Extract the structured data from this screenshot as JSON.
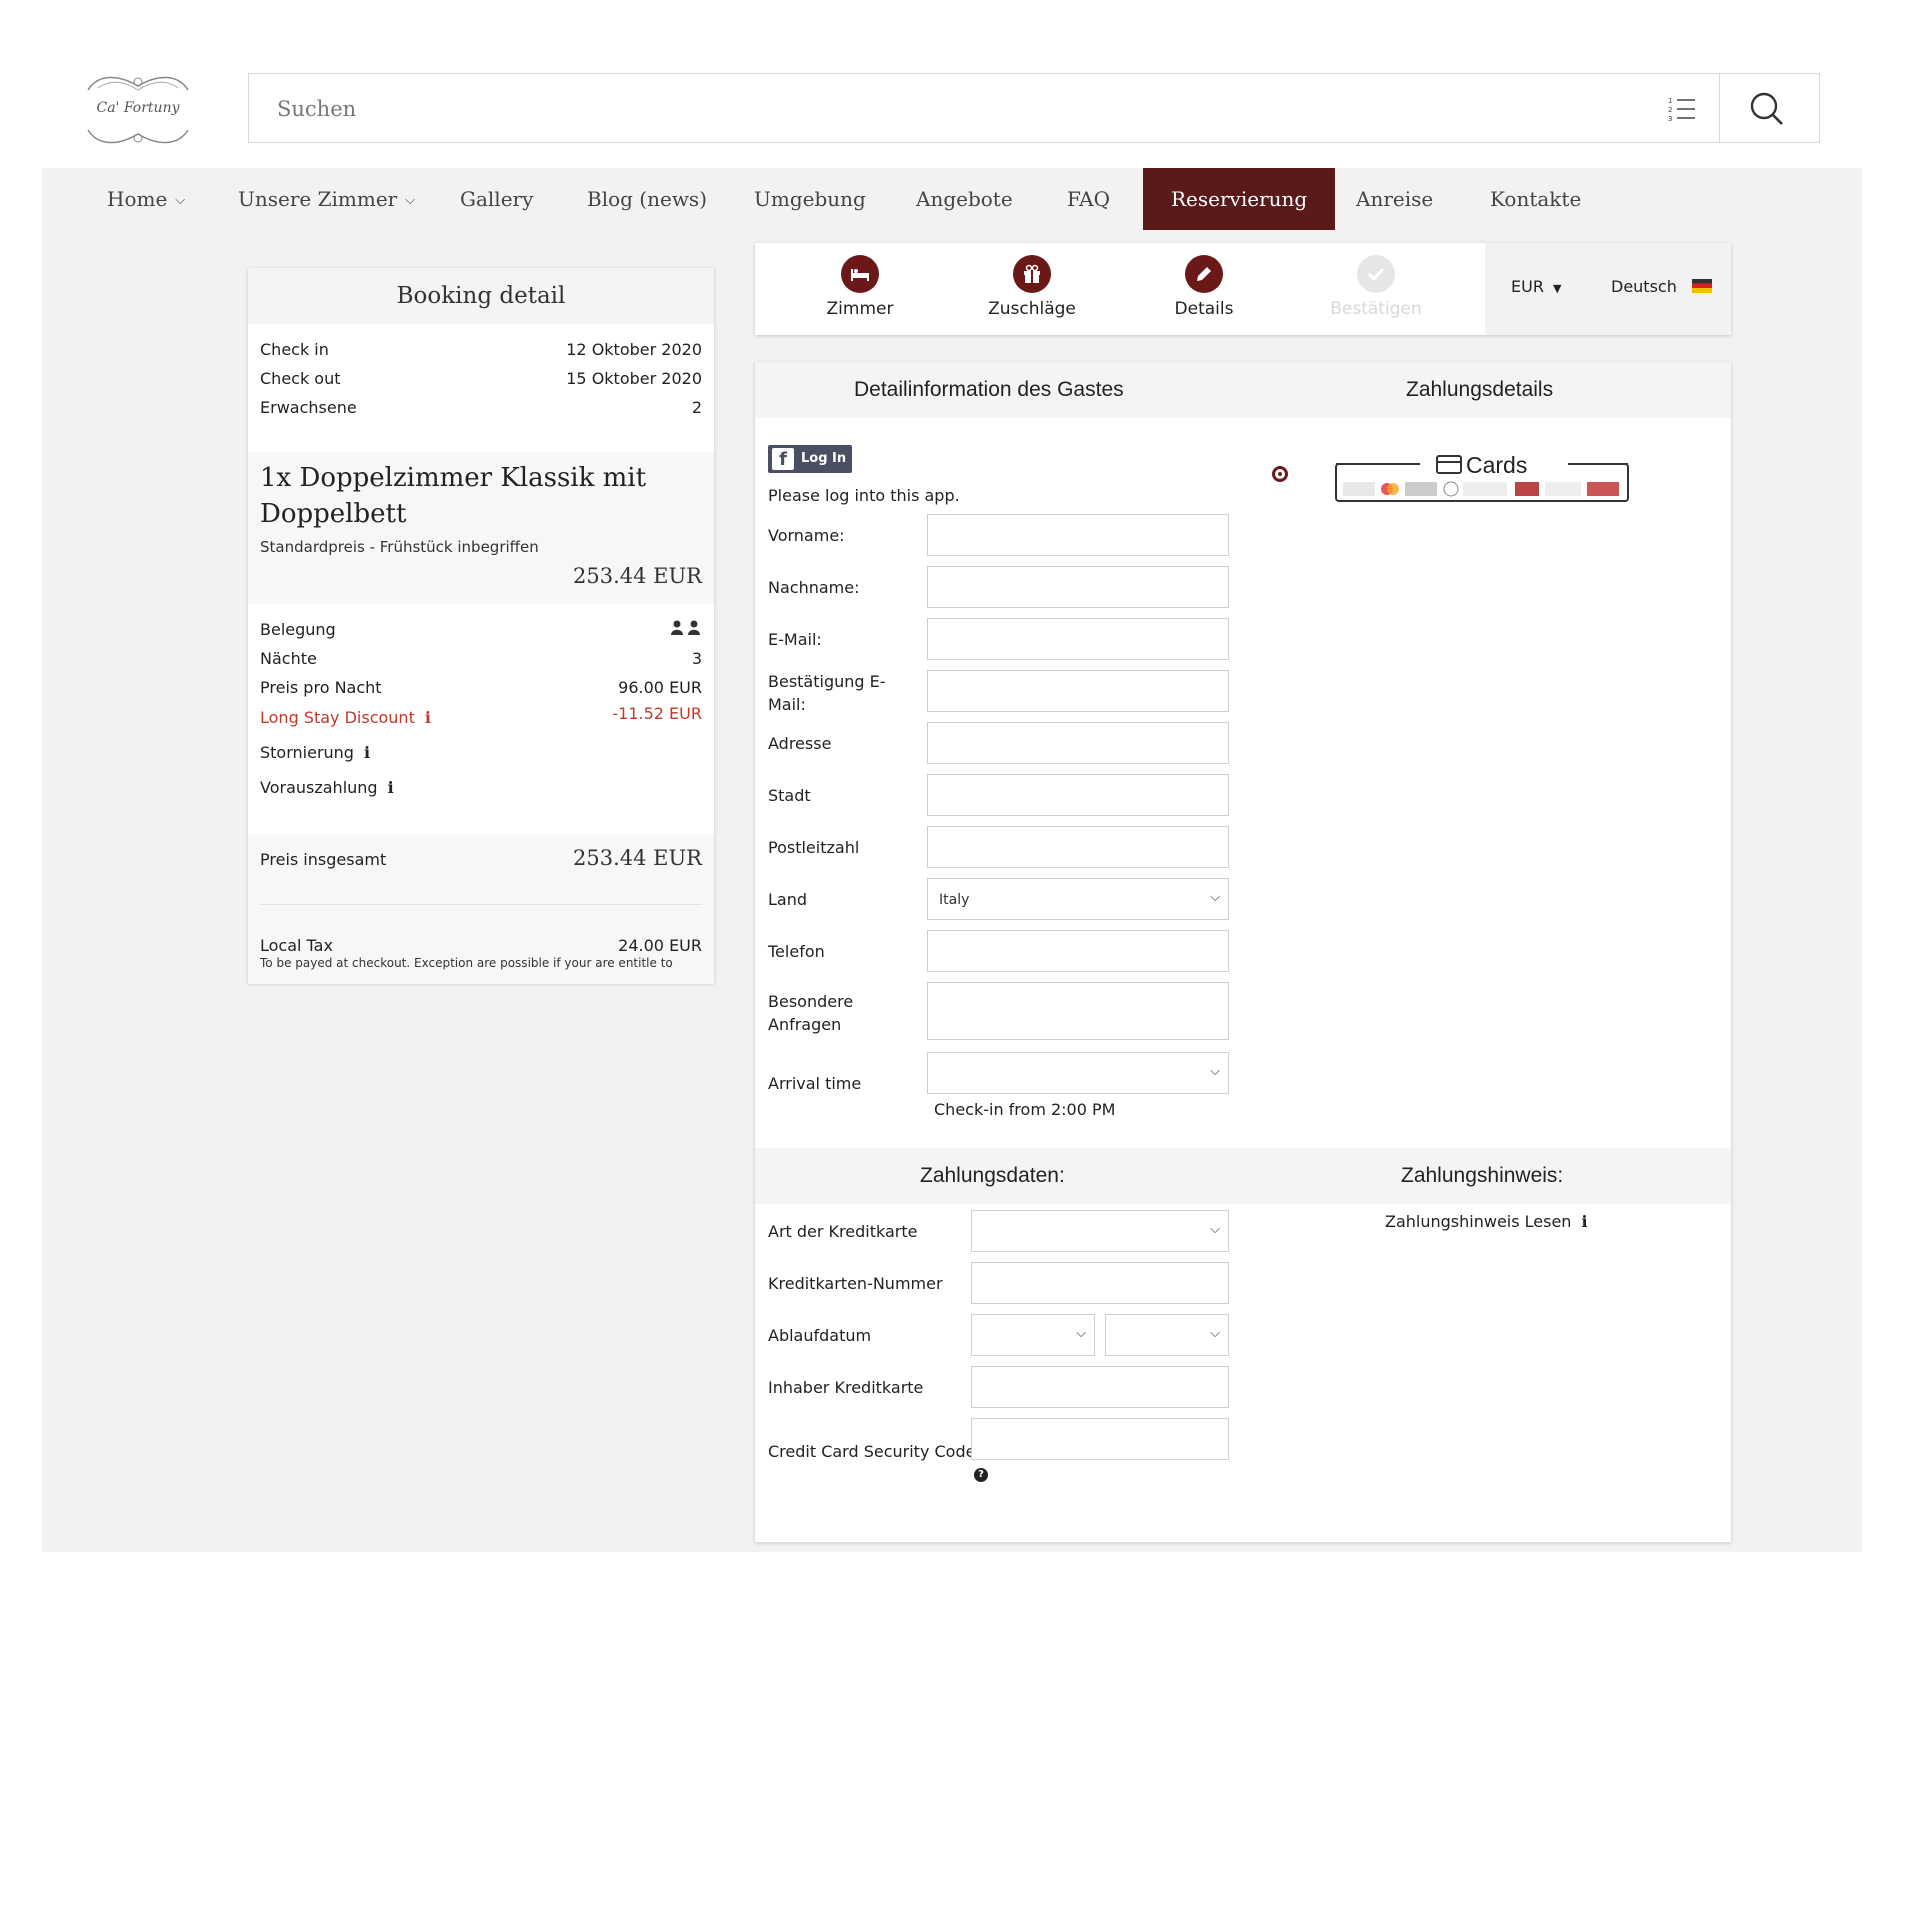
{
  "logo": {
    "text": "Ca' Fortuny"
  },
  "search": {
    "placeholder": "Suchen"
  },
  "nav": {
    "items": [
      "Home",
      "Unsere Zimmer",
      "Gallery",
      "Blog (news)",
      "Umgebung",
      "Angebote",
      "FAQ",
      "Reservierung",
      "Anreise",
      "Kontakte"
    ],
    "active": "Reservierung"
  },
  "booking": {
    "title": "Booking detail",
    "check_in_label": "Check in",
    "check_in": "12 Oktober 2020",
    "check_out_label": "Check out",
    "check_out": "15 Oktober 2020",
    "adults_label": "Erwachsene",
    "adults": "2",
    "room_title": "1x Doppelzimmer Klassik mit Doppelbett",
    "room_rate": "Standardpreis - Frühstück inbegriffen",
    "room_price": "253.44 EUR",
    "occupancy_label": "Belegung",
    "nights_label": "Nächte",
    "nights": "3",
    "price_per_night_label": "Preis pro Nacht",
    "price_per_night": "96.00 EUR",
    "discount_label": "Long Stay Discount",
    "discount": "-11.52 EUR",
    "cancellation_label": "Stornierung",
    "prepayment_label": "Vorauszahlung",
    "total_label": "Preis insgesamt",
    "total": "253.44 EUR",
    "local_tax_label": "Local Tax",
    "local_tax": "24.00 EUR",
    "local_tax_note": "To be payed at checkout. Exception are possible if your are entitle to"
  },
  "steps": [
    {
      "label": "Zimmer",
      "icon": "bed-icon"
    },
    {
      "label": "Zuschläge",
      "icon": "gift-icon"
    },
    {
      "label": "Details",
      "icon": "pencil-icon"
    },
    {
      "label": "Bestätigen",
      "icon": "check-icon"
    }
  ],
  "currency": "EUR",
  "language": "Deutsch",
  "form": {
    "guest_header": "Detailinformation des Gastes",
    "payment_header": "Zahlungsdetails",
    "fb_login": "Log In",
    "login_prompt": "Please log into this app.",
    "labels": {
      "first_name": "Vorname:",
      "last_name": "Nachname:",
      "email": "E-Mail:",
      "email_confirm": "Bestätigung E-Mail:",
      "address": "Adresse",
      "city": "Stadt",
      "zip": "Postleitzahl",
      "country": "Land",
      "phone": "Telefon",
      "requests": "Besondere Anfragen",
      "arrival": "Arrival time"
    },
    "country_value": "Italy",
    "checkin_hint": "Check-in from 2:00 PM",
    "cards_label": "Cards",
    "payment_data_header": "Zahlungsdaten:",
    "payment_note_header": "Zahlungshinweis:",
    "payment_note_link": "Zahlungshinweis Lesen",
    "cc_type": "Art der Kreditkarte",
    "cc_number": "Kreditkarten-Nummer",
    "cc_expiry": "Ablaufdatum",
    "cc_holder": "Inhaber Kreditkarte",
    "cc_cvc": "Credit Card Security Code"
  },
  "colors": {
    "accent": "#5a1a1a",
    "discount": "#c0392b",
    "panel_bg": "#f2f2f2"
  }
}
